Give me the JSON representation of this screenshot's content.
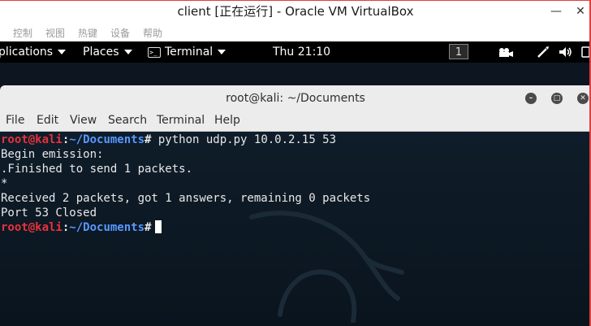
{
  "host_window": {
    "title": "client [正在运行] - Oracle VM VirtualBox",
    "menu": [
      "控制",
      "视图",
      "热键",
      "设备",
      "帮助"
    ]
  },
  "top_bar": {
    "applications": "plications",
    "places": "Places",
    "terminal": "Terminal",
    "clock": "Thu 21:10",
    "workspace": "1"
  },
  "terminal_window": {
    "title": "root@kali: ~/Documents",
    "menu": [
      "File",
      "Edit",
      "View",
      "Search",
      "Terminal",
      "Help"
    ]
  },
  "prompt": {
    "user_host": "root@kali",
    "colon": ":",
    "path": "~/Documents",
    "symbol": "#"
  },
  "command": " python udp.py 10.0.2.15 53",
  "output": [
    "Begin emission:",
    ".Finished to send 1 packets.",
    "*",
    "Received 2 packets, got 1 answers, remaining 0 packets",
    "Port 53 Closed"
  ],
  "colors": {
    "prompt_user": "#e5323c",
    "prompt_path": "#5797ff",
    "terminal_bg": "#0c1520"
  }
}
